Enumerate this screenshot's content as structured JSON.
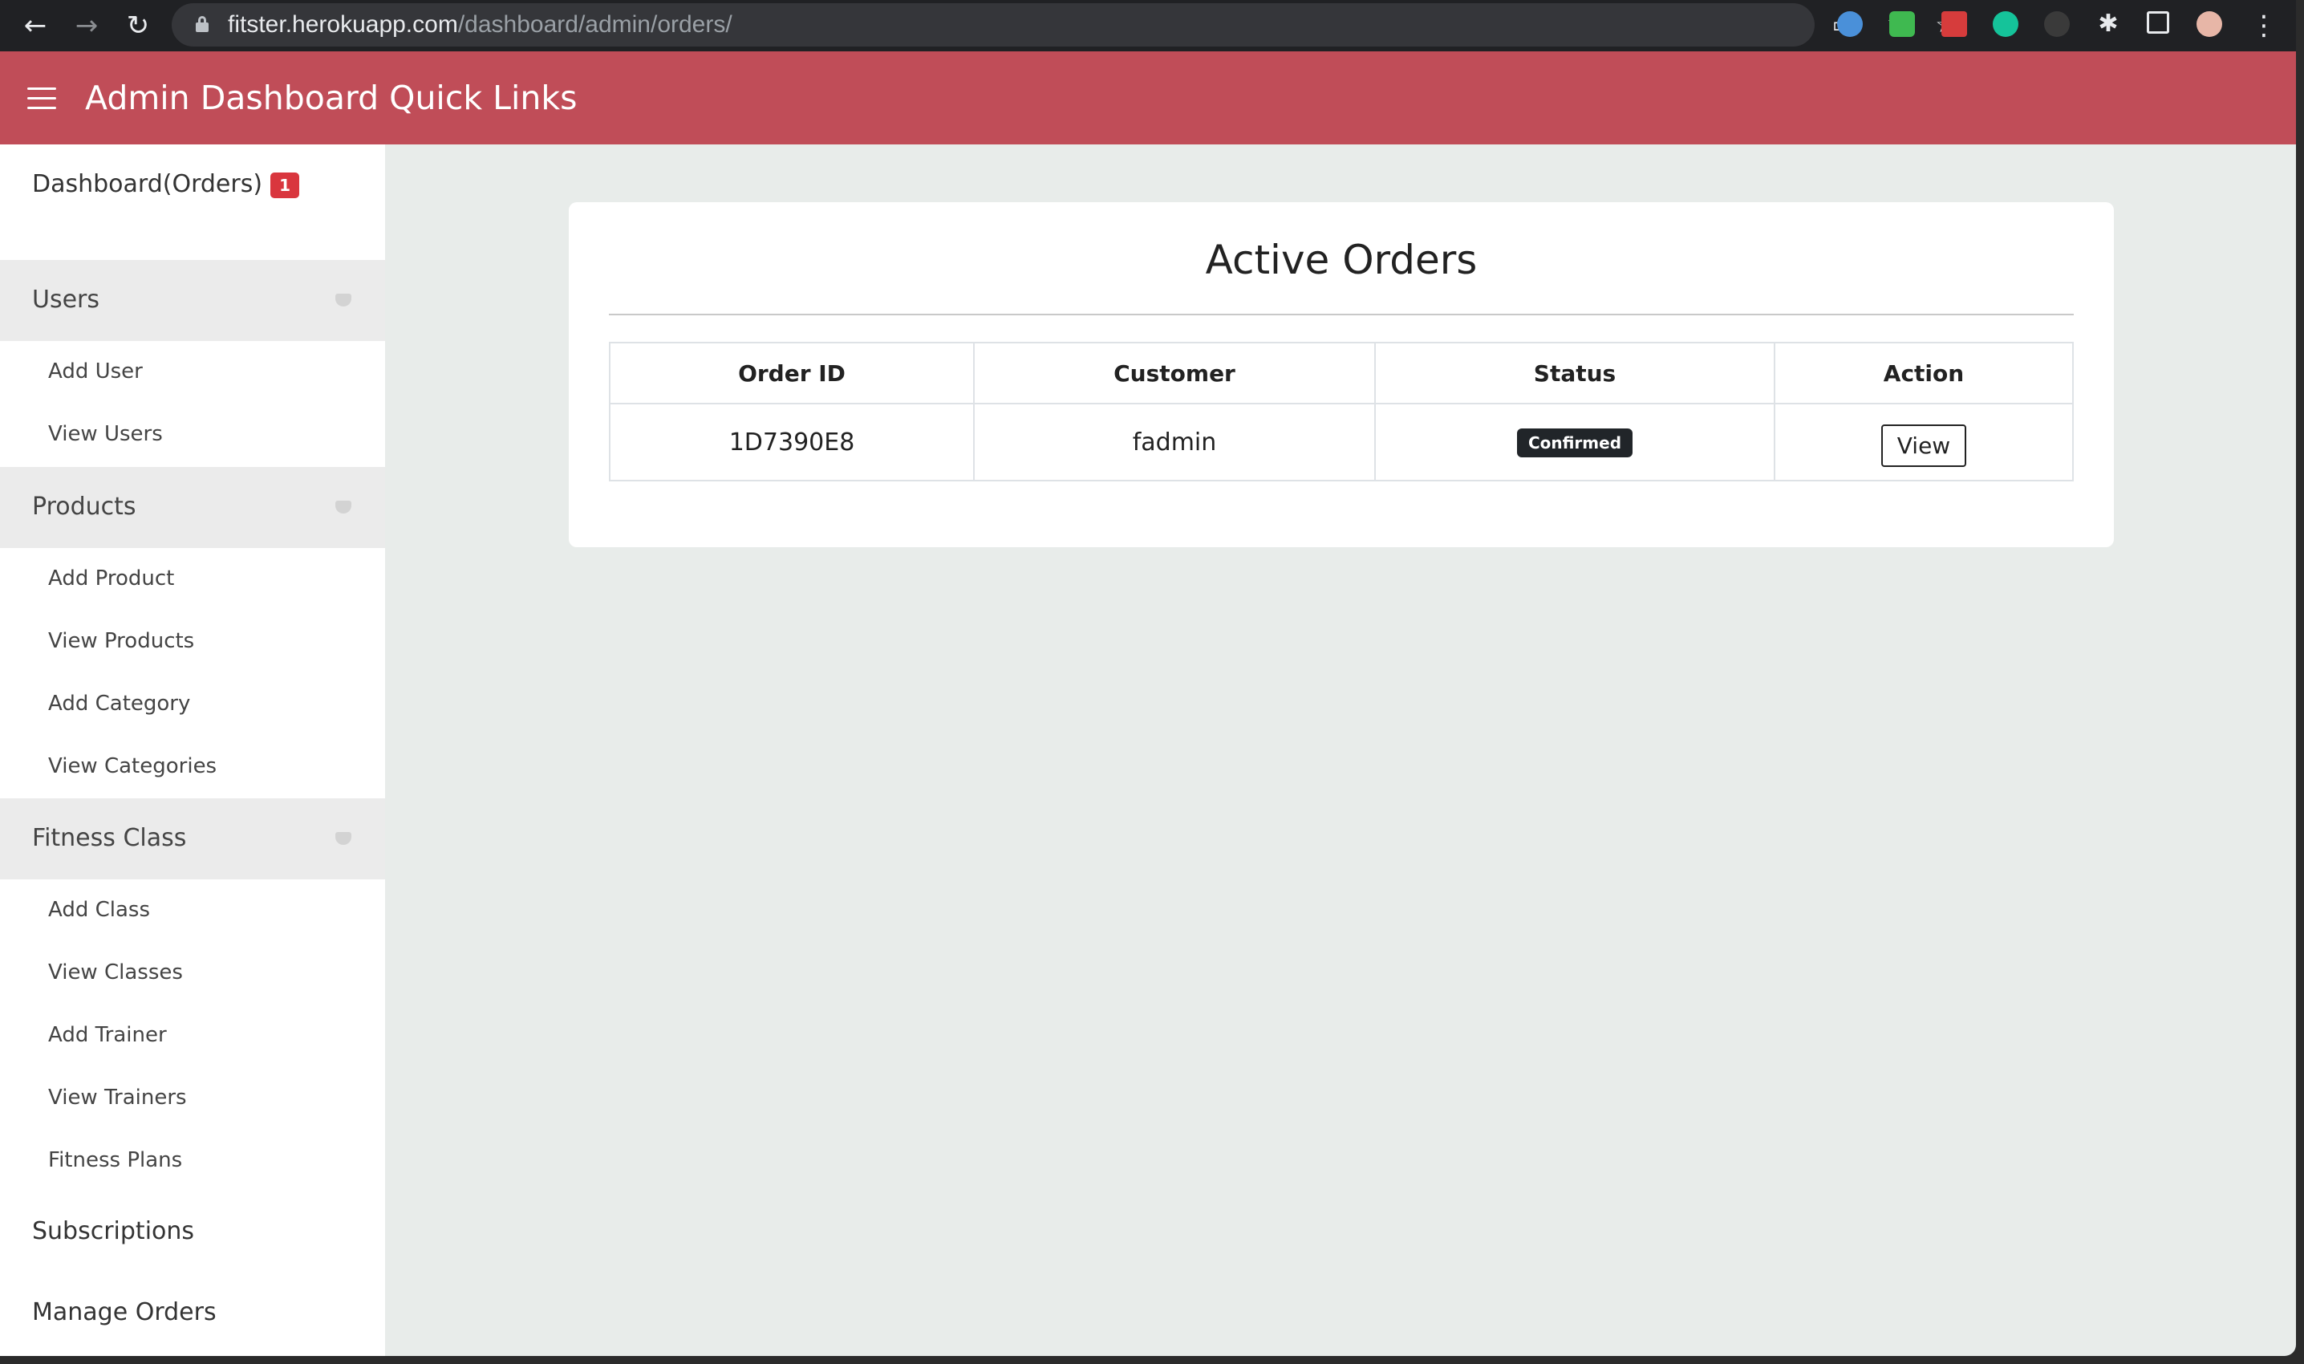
{
  "browser": {
    "url_host": "fitster.herokuapp.com",
    "url_path": "/dashboard/admin/orders/",
    "back_icon": "←",
    "forward_icon": "→",
    "reload_icon": "↻",
    "menu_icon": "⋮"
  },
  "header": {
    "title": "Admin Dashboard Quick Links",
    "color": "#c04d58"
  },
  "sidebar": {
    "dashboard": {
      "label": "Dashboard(Orders)",
      "badge": "1"
    },
    "groups": [
      {
        "label": "Users",
        "items": [
          "Add User",
          "View Users"
        ]
      },
      {
        "label": "Products",
        "items": [
          "Add Product",
          "View Products",
          "Add Category",
          "View Categories"
        ]
      },
      {
        "label": "Fitness Class",
        "items": [
          "Add Class",
          "View Classes",
          "Add Trainer",
          "View Trainers",
          "Fitness Plans"
        ]
      }
    ],
    "subscriptions": "Subscriptions",
    "manage_orders": "Manage Orders"
  },
  "main": {
    "title": "Active Orders",
    "table": {
      "headers": [
        "Order ID",
        "Customer",
        "Status",
        "Action"
      ],
      "rows": [
        {
          "order_id": "1D7390E8",
          "customer": "fadmin",
          "status": "Confirmed",
          "action": "View"
        }
      ]
    }
  }
}
